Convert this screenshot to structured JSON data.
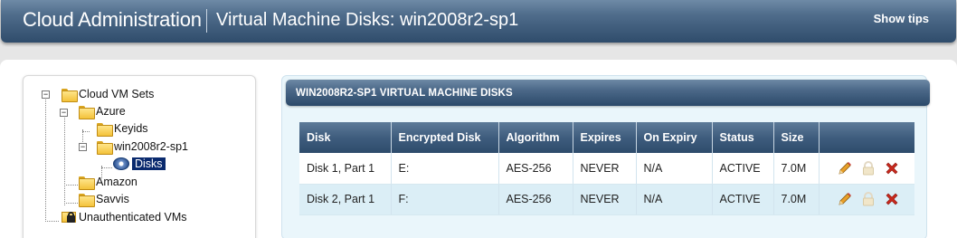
{
  "header": {
    "app_title": "Cloud Administration",
    "page_title": "Virtual Machine Disks: win2008r2-sp1",
    "show_tips": "Show tips"
  },
  "tree": {
    "root": "Cloud VM Sets",
    "azure": "Azure",
    "keyids": "Keyids",
    "vm": "win2008r2-sp1",
    "disks": "Disks",
    "amazon": "Amazon",
    "savvis": "Savvis",
    "unauth": "Unauthenticated VMs"
  },
  "panel": {
    "title": "WIN2008R2-SP1 VIRTUAL MACHINE DISKS",
    "columns": [
      "Disk",
      "Encrypted Disk",
      "Algorithm",
      "Expires",
      "On Expiry",
      "Status",
      "Size",
      ""
    ],
    "rows": [
      {
        "disk": "Disk 1, Part 1",
        "encrypted": "E:",
        "algorithm": "AES-256",
        "expires": "NEVER",
        "on_expiry": "N/A",
        "status": "ACTIVE",
        "size": "7.0M"
      },
      {
        "disk": "Disk 2, Part 1",
        "encrypted": "F:",
        "algorithm": "AES-256",
        "expires": "NEVER",
        "on_expiry": "N/A",
        "status": "ACTIVE",
        "size": "7.0M"
      }
    ]
  },
  "icons": {
    "edit": "pencil-icon",
    "lock": "lock-icon",
    "delete": "delete-x-icon"
  },
  "colors": {
    "header_bg": "#2f4c6b",
    "selected_node": "#0a2a6e",
    "delete_red": "#c8281c"
  }
}
